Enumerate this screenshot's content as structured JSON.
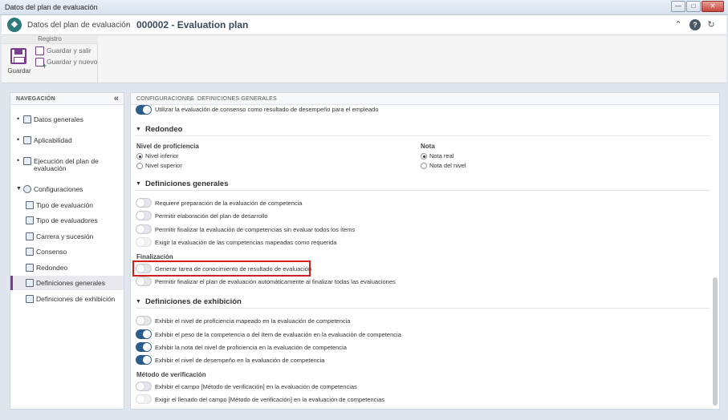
{
  "window": {
    "title": "Datos del plan de evaluación"
  },
  "header": {
    "app_name": "Datos del plan de evaluación",
    "separator": "›",
    "record_title": "000002 - Evaluation plan"
  },
  "ribbon": {
    "group_title": "Registro",
    "save_label": "Guardar",
    "save_exit_label": "Guardar y salir",
    "save_new_label": "Guardar y nuevo"
  },
  "nav": {
    "header": "NAVEGACIÓN",
    "collapse_glyph": "«",
    "items": [
      {
        "label": "Datos generales"
      },
      {
        "label": "Aplicabilidad"
      },
      {
        "label": "Ejecución del plan de evaluación",
        "line1": "Ejecución del plan de",
        "line2": "evaluación"
      },
      {
        "label": "Configuraciones"
      },
      {
        "label": "Tipo de evaluación"
      },
      {
        "label": "Tipo de evaluadores"
      },
      {
        "label": "Carrera y sucesión"
      },
      {
        "label": "Consenso"
      },
      {
        "label": "Redondeo"
      },
      {
        "label": "Definiciones generales",
        "active": true
      },
      {
        "label": "Definiciones de exhibición"
      }
    ]
  },
  "content": {
    "breadcrumb": {
      "part1": "CONFIGURACIONES",
      "sep": "›",
      "part2": "DEFINICIONES GENERALES"
    },
    "consensus_row": {
      "label": "Utilizar la evaluación de consenso como resultado de desempeño para el empleado",
      "on": true
    },
    "redondeo": {
      "title": "Redondeo",
      "nivel_label": "Nivel de proficiencia",
      "nivel_options": [
        {
          "label": "Nivel inferior",
          "selected": true
        },
        {
          "label": "Nivel superior",
          "selected": false
        }
      ],
      "nota_label": "Nota",
      "nota_options": [
        {
          "label": "Nota real",
          "selected": true
        },
        {
          "label": "Nota del nivel",
          "selected": false
        }
      ]
    },
    "generales": {
      "title": "Definiciones generales",
      "rows": [
        {
          "label": "Requiere preparación de la evaluación de competencia",
          "on": false
        },
        {
          "label": "Permitir elaboración del plan de desarrollo",
          "on": false
        },
        {
          "label": "Permitir finalizar la evaluación de competencias sin evaluar todos los ítems",
          "on": false
        },
        {
          "label": "Exigir la evaluación de las competencias mapeadas como requerida",
          "on": false
        }
      ],
      "finalizacion_label": "Finalización",
      "finalizacion_rows": [
        {
          "label": "Generar tarea de conocimiento de resultado de evaluación",
          "on": false
        },
        {
          "label": "Permitir finalizar el plan de evaluación automáticamente al finalizar todas las evaluaciones",
          "on": false
        }
      ]
    },
    "exhibicion": {
      "title": "Definiciones de exhibición",
      "rows": [
        {
          "label": "Exhibir el nivel de proficiencia mapeado en la evaluación de competencia",
          "on": false
        },
        {
          "label": "Exhibir el peso de la competencia o del ítem de evaluación en la evaluación de competencia",
          "on": true
        },
        {
          "label": "Exhibir la nota del nivel de proficiencia en la evaluación de competencia",
          "on": true
        },
        {
          "label": "Exhibir el nivel de desempeño en la evaluación de competencia",
          "on": true
        }
      ],
      "metodo_label": "Método de verificación",
      "metodo_rows": [
        {
          "label": "Exhibir el campo [Método de verificación] en la evaluación de competencias",
          "on": false
        },
        {
          "label": "Exigir el llenado del campo [Método de verificación] en la evaluación de competencias",
          "on": false
        }
      ]
    }
  }
}
